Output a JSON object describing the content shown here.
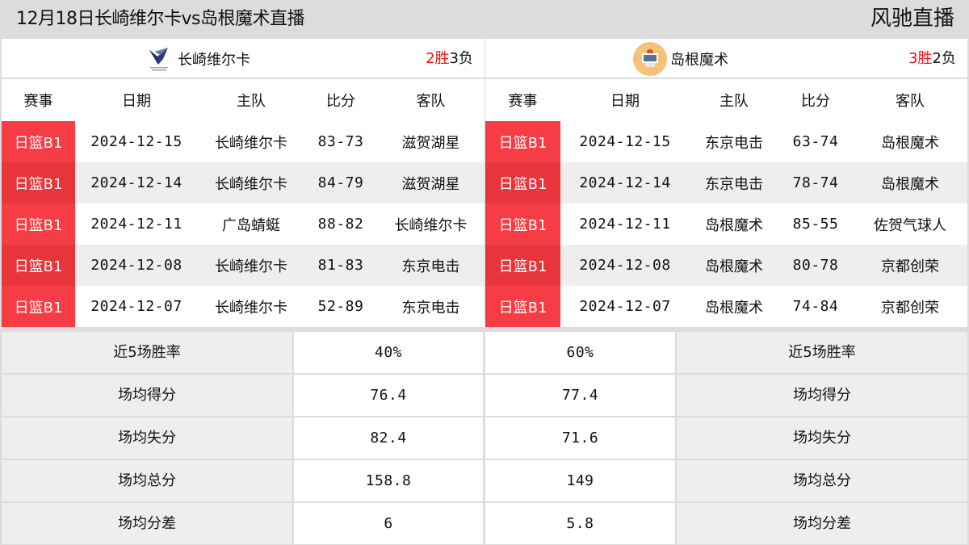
{
  "header": {
    "title": "12月18日长崎维尔卡vs岛根魔术直播",
    "brand": "风驰直播"
  },
  "colors": {
    "league_badge": "#f63d45",
    "win_text": "#f01414",
    "header_bg": "#dcdcdc",
    "alt_row_bg": "#efeeef"
  },
  "left_team": {
    "name": "长崎维尔卡",
    "logo": "nagasaki-velca-logo",
    "record": {
      "wins": "2胜",
      "losses": "3负"
    },
    "columns": [
      "赛事",
      "日期",
      "主队",
      "比分",
      "客队"
    ],
    "games": [
      {
        "league": "日篮B1",
        "date": "2024-12-15",
        "home": "长崎维尔卡",
        "score": "83-73",
        "away": "滋贺湖星"
      },
      {
        "league": "日篮B1",
        "date": "2024-12-14",
        "home": "长崎维尔卡",
        "score": "84-79",
        "away": "滋贺湖星"
      },
      {
        "league": "日篮B1",
        "date": "2024-12-11",
        "home": "广岛蜻蜓",
        "score": "88-82",
        "away": "长崎维尔卡"
      },
      {
        "league": "日篮B1",
        "date": "2024-12-08",
        "home": "长崎维尔卡",
        "score": "81-83",
        "away": "东京电击"
      },
      {
        "league": "日篮B1",
        "date": "2024-12-07",
        "home": "长崎维尔卡",
        "score": "52-89",
        "away": "东京电击"
      }
    ]
  },
  "right_team": {
    "name": "岛根魔术",
    "logo": "shimane-magic-logo",
    "record": {
      "wins": "3胜",
      "losses": "2负"
    },
    "columns": [
      "赛事",
      "日期",
      "主队",
      "比分",
      "客队"
    ],
    "games": [
      {
        "league": "日篮B1",
        "date": "2024-12-15",
        "home": "东京电击",
        "score": "63-74",
        "away": "岛根魔术"
      },
      {
        "league": "日篮B1",
        "date": "2024-12-14",
        "home": "东京电击",
        "score": "78-74",
        "away": "岛根魔术"
      },
      {
        "league": "日篮B1",
        "date": "2024-12-11",
        "home": "岛根魔术",
        "score": "85-55",
        "away": "佐贺气球人"
      },
      {
        "league": "日篮B1",
        "date": "2024-12-08",
        "home": "岛根魔术",
        "score": "80-78",
        "away": "京都创荣"
      },
      {
        "league": "日篮B1",
        "date": "2024-12-07",
        "home": "岛根魔术",
        "score": "74-84",
        "away": "京都创荣"
      }
    ]
  },
  "stats": [
    {
      "label": "近5场胜率",
      "left": "40%",
      "right": "60%"
    },
    {
      "label": "场均得分",
      "left": "76.4",
      "right": "77.4"
    },
    {
      "label": "场均失分",
      "left": "82.4",
      "right": "71.6"
    },
    {
      "label": "场均总分",
      "left": "158.8",
      "right": "149"
    },
    {
      "label": "场均分差",
      "left": "6",
      "right": "5.8"
    }
  ]
}
